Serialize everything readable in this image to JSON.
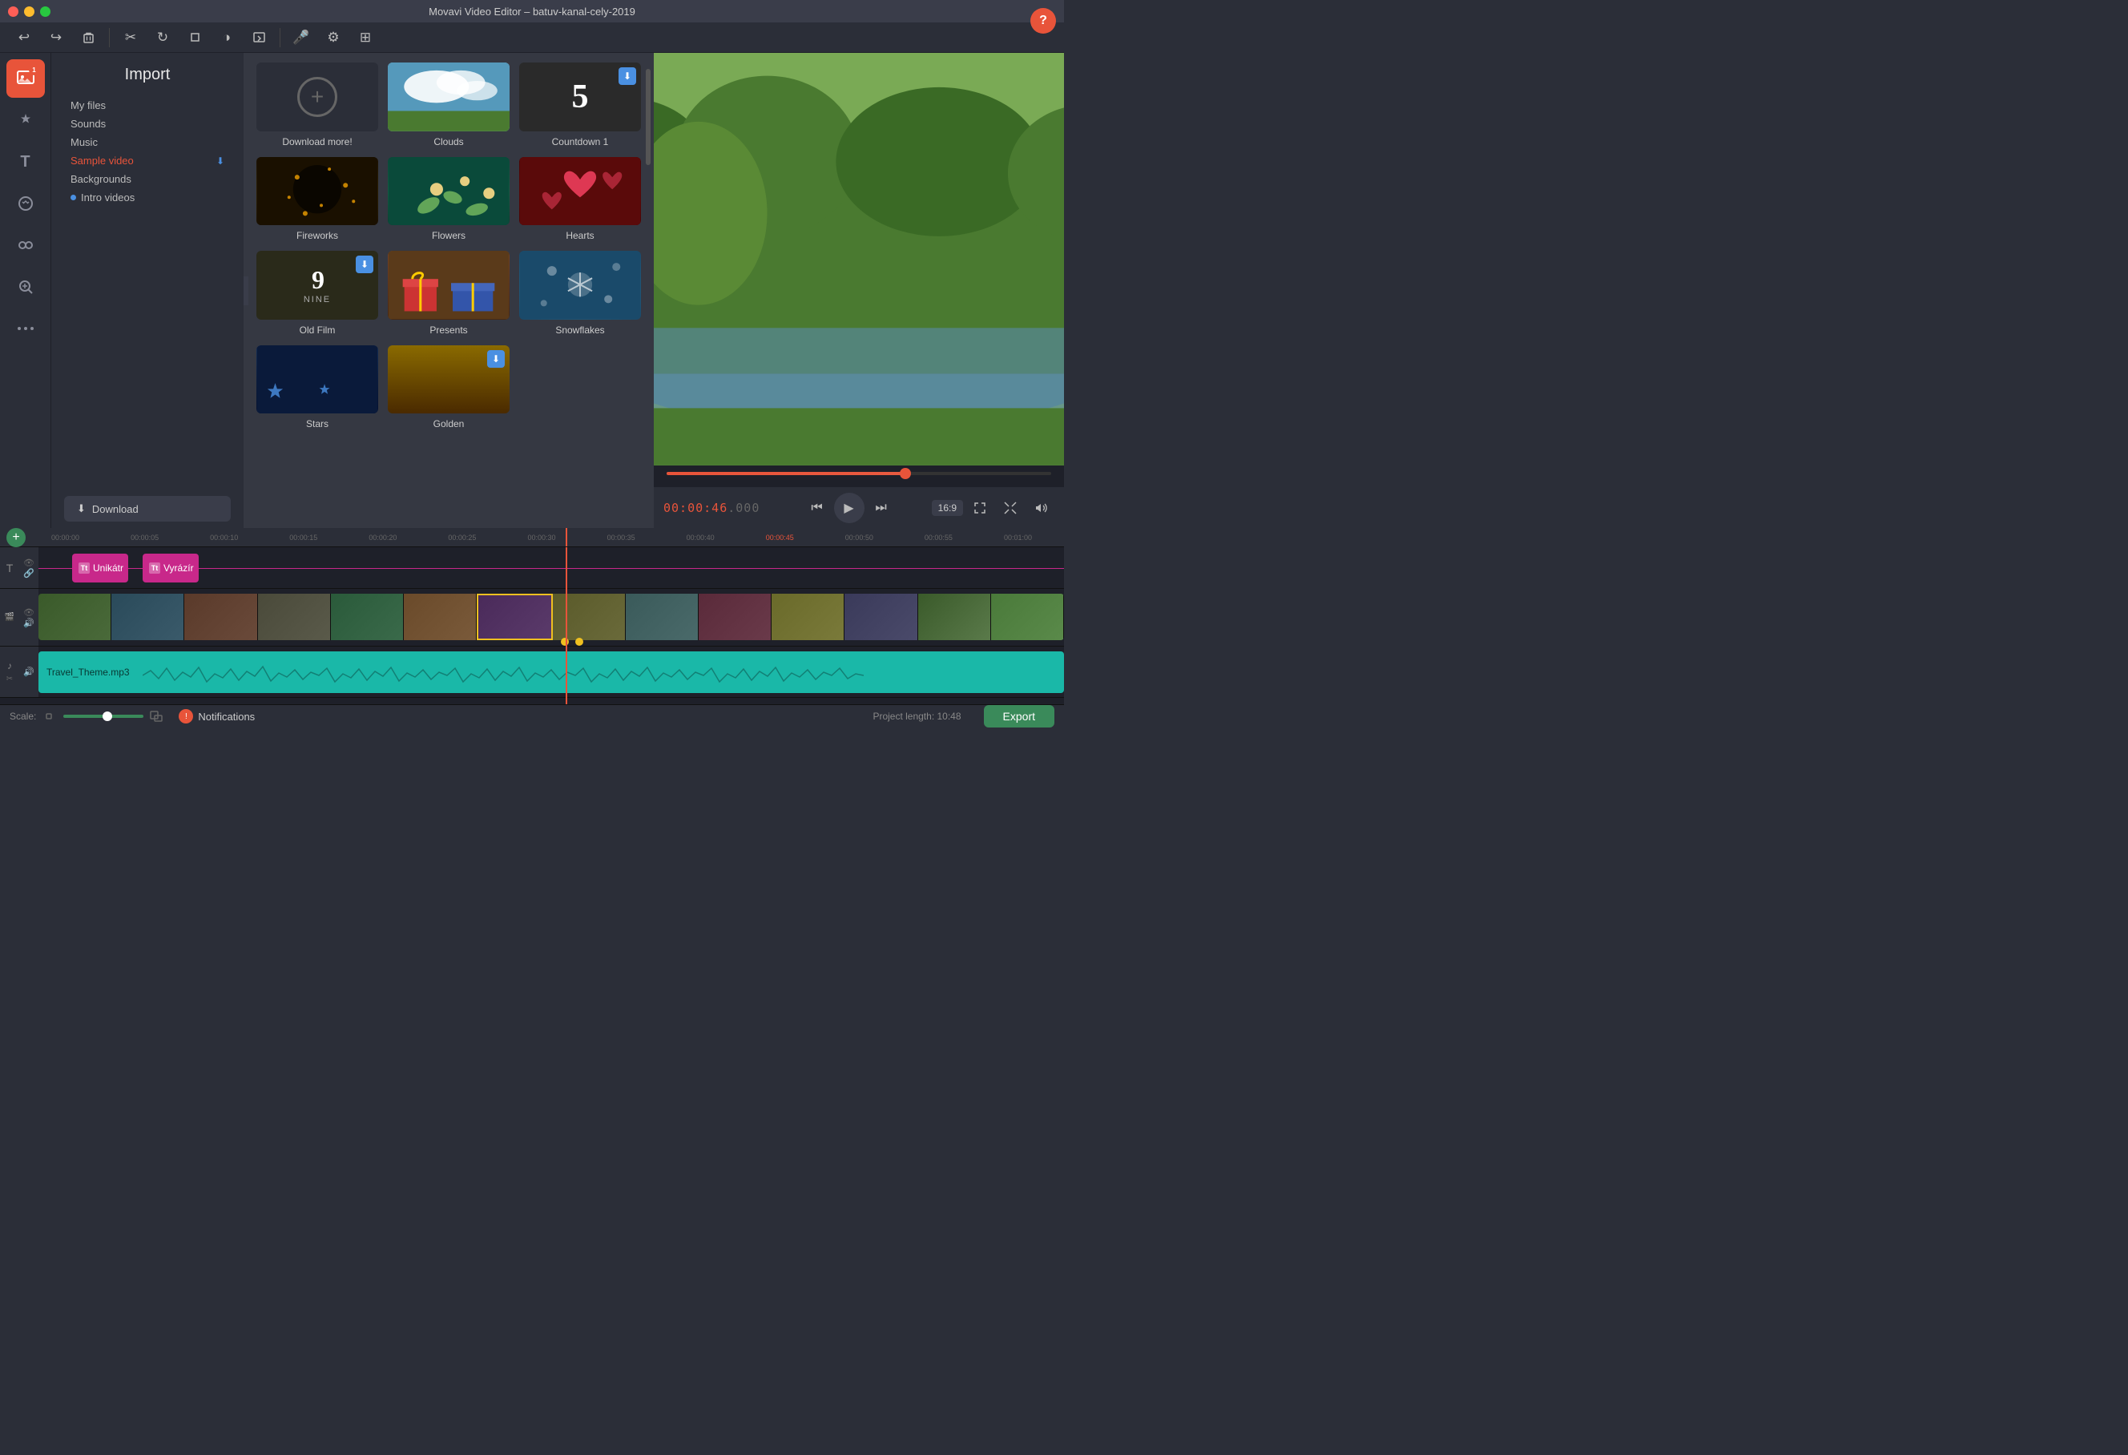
{
  "titlebar": {
    "title": "Movavi Video Editor – batuv-kanal-cely-2019",
    "traffic_lights": [
      "red",
      "yellow",
      "green"
    ]
  },
  "sidebar": {
    "items": [
      {
        "id": "import",
        "icon": "🎬",
        "label": "Import",
        "active": true,
        "badge": "1"
      },
      {
        "id": "effects",
        "icon": "✨",
        "label": "Effects"
      },
      {
        "id": "text",
        "icon": "T",
        "label": "Text"
      },
      {
        "id": "stickers",
        "icon": "★",
        "label": "Stickers"
      },
      {
        "id": "transitions",
        "icon": "⇄",
        "label": "Transitions"
      },
      {
        "id": "zoom",
        "icon": "⊕",
        "label": "Zoom"
      },
      {
        "id": "more",
        "icon": "≡",
        "label": "More"
      }
    ]
  },
  "import_panel": {
    "title": "Import",
    "nav_items": [
      {
        "id": "my-files",
        "label": "My files"
      },
      {
        "id": "sounds",
        "label": "Sounds"
      },
      {
        "id": "music",
        "label": "Music"
      },
      {
        "id": "sample-video",
        "label": "Sample video",
        "active": true,
        "has_download": true
      },
      {
        "id": "backgrounds",
        "label": "Backgrounds"
      },
      {
        "id": "intro-videos",
        "label": "Intro videos",
        "has_dot": true
      }
    ],
    "download_button": "Download"
  },
  "media_grid": {
    "items": [
      {
        "id": "download-more",
        "label": "Download more!",
        "type": "download-more"
      },
      {
        "id": "clouds",
        "label": "Clouds",
        "type": "clouds"
      },
      {
        "id": "countdown",
        "label": "Countdown 1",
        "type": "countdown",
        "has_download": true
      },
      {
        "id": "fireworks",
        "label": "Fireworks",
        "type": "fireworks",
        "has_download": true
      },
      {
        "id": "flowers",
        "label": "Flowers",
        "type": "flowers",
        "has_download": true
      },
      {
        "id": "hearts",
        "label": "Hearts",
        "type": "hearts",
        "has_download": true
      },
      {
        "id": "old-film",
        "label": "Old Film",
        "type": "oldfilm",
        "has_download": true
      },
      {
        "id": "presents",
        "label": "Presents",
        "type": "presents",
        "has_download": true
      },
      {
        "id": "snowflakes",
        "label": "Snowflakes",
        "type": "snowflakes",
        "has_download": true
      },
      {
        "id": "stars",
        "label": "Stars",
        "type": "stars",
        "has_download": true
      },
      {
        "id": "golden",
        "label": "Golden",
        "type": "golden",
        "has_download": true
      }
    ]
  },
  "preview": {
    "time_current": "00:00:46",
    "time_milliseconds": ".000",
    "aspect_ratio": "16:9"
  },
  "edit_toolbar": {
    "buttons": [
      {
        "id": "undo",
        "icon": "↩",
        "label": "Undo"
      },
      {
        "id": "redo",
        "icon": "↪",
        "label": "Redo"
      },
      {
        "id": "delete",
        "icon": "🗑",
        "label": "Delete"
      },
      {
        "id": "cut",
        "icon": "✂",
        "label": "Cut"
      },
      {
        "id": "rotate",
        "icon": "↻",
        "label": "Rotate"
      },
      {
        "id": "crop",
        "icon": "⊡",
        "label": "Crop"
      },
      {
        "id": "color",
        "icon": "◑",
        "label": "Color"
      },
      {
        "id": "export-clip",
        "icon": "⬡",
        "label": "Export clip"
      },
      {
        "id": "audio",
        "icon": "🎤",
        "label": "Audio"
      },
      {
        "id": "settings",
        "icon": "⚙",
        "label": "Settings"
      },
      {
        "id": "more-tools",
        "icon": "⊞",
        "label": "More tools"
      }
    ]
  },
  "timeline": {
    "ruler_marks": [
      "00:00:00",
      "00:00:05",
      "00:00:10",
      "00:00:15",
      "00:00:20",
      "00:00:25",
      "00:00:30",
      "00:00:35",
      "00:00:40",
      "00:00:45",
      "00:00:50",
      "00:00:55",
      "00:01:00"
    ],
    "tracks": [
      {
        "type": "text",
        "clips": [
          {
            "label": "Unikátr",
            "left_pct": 5,
            "width_pct": 7
          },
          {
            "label": "Vyrázír",
            "left_pct": 14,
            "width_pct": 7
          }
        ]
      },
      {
        "type": "video",
        "frames": 14
      },
      {
        "type": "audio",
        "label": "Travel_Theme.mp3"
      }
    ],
    "playhead_position": "00:00:45"
  },
  "bottom_bar": {
    "scale_label": "Scale:",
    "notifications_label": "Notifications",
    "project_length_label": "Project length:",
    "project_length_value": "10:48",
    "export_label": "Export"
  },
  "help_button_label": "?"
}
